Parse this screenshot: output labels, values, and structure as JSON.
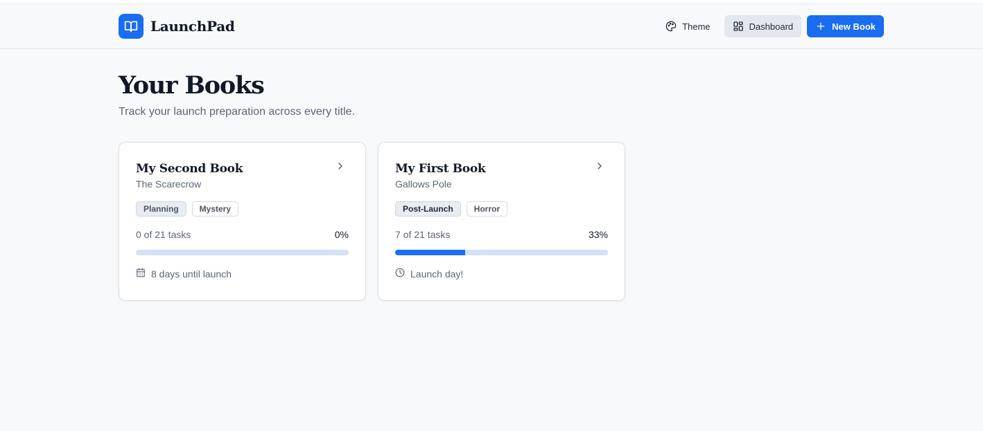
{
  "app": {
    "name": "LaunchPad"
  },
  "nav": {
    "theme_label": "Theme",
    "dashboard_label": "Dashboard",
    "new_book_label": "New Book"
  },
  "page": {
    "title": "Your Books",
    "subtitle": "Track your launch preparation across every title."
  },
  "books": [
    {
      "title": "My Second Book",
      "subtitle": "The Scarecrow",
      "stage": "Planning",
      "genre": "Mystery",
      "tasks_text": "0 of 21 tasks",
      "percent_text": "0%",
      "progress": 0,
      "launch_text": "8 days until launch",
      "launch_icon": "calendar-icon"
    },
    {
      "title": "My First Book",
      "subtitle": "Gallows Pole",
      "stage": "Post-Launch",
      "genre": "Horror",
      "tasks_text": "7 of 21 tasks",
      "percent_text": "33%",
      "progress": 0.33,
      "launch_text": "Launch day!",
      "launch_icon": "clock-icon"
    }
  ],
  "colors": {
    "accent": "#1a6cf0",
    "progress_track": "#d4e2f9",
    "background": "#f8f9fb"
  }
}
